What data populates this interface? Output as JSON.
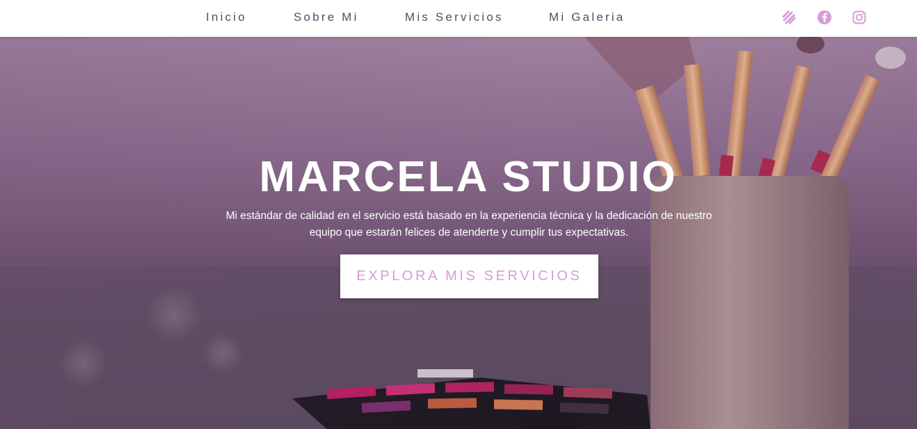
{
  "nav": {
    "links": [
      {
        "label": "Inicio"
      },
      {
        "label": "Sobre Mi"
      },
      {
        "label": "Mis Servicios"
      },
      {
        "label": "Mi Galeria"
      }
    ],
    "social": [
      {
        "icon": "squarespace-icon"
      },
      {
        "icon": "facebook-icon"
      },
      {
        "icon": "instagram-icon"
      }
    ],
    "social_color": "#d89bd6",
    "text_color": "#4a4f63"
  },
  "hero": {
    "title": "MARCELA STUDIO",
    "subtitle_line1": "Mi estándar de calidad en el servicio está basado en la experiencia técnica y la dedicación de nuestro",
    "subtitle_line2": "equipo que estarán felices de atenderte y cumplir tus expectativas.",
    "cta_label": "EXPLORA MIS SERVICIOS",
    "overlay_color": "#8d6d8f",
    "cta_text_color": "#d89bd6"
  }
}
